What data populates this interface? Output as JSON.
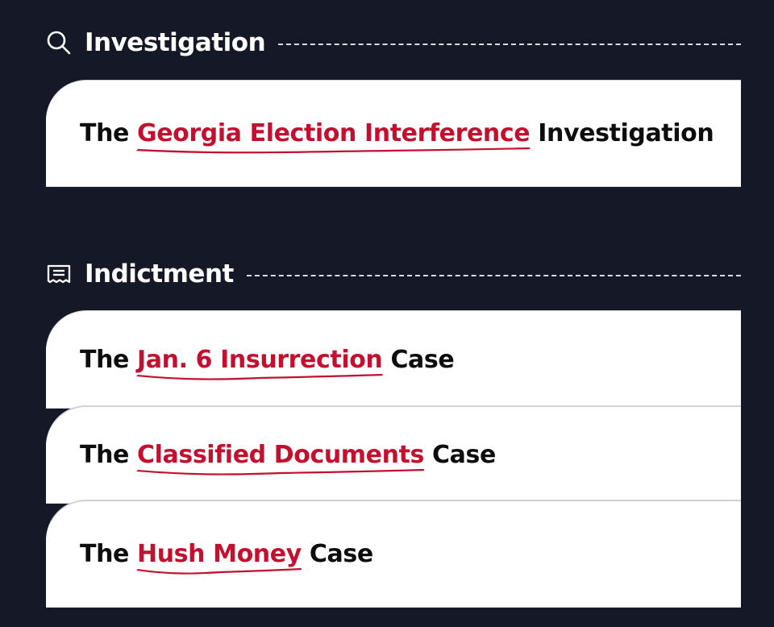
{
  "sections": [
    {
      "title": "Investigation",
      "icon": "search-icon",
      "cards": [
        {
          "prefix": "The",
          "link": "Georgia Election Interference",
          "suffix": "Investigation"
        }
      ]
    },
    {
      "title": "Indictment",
      "icon": "receipt-icon",
      "cards": [
        {
          "prefix": "The",
          "link": "Jan. 6 Insurrection",
          "suffix": "Case"
        },
        {
          "prefix": "The",
          "link": "Classified Documents",
          "suffix": "Case"
        },
        {
          "prefix": "The",
          "link": "Hush Money",
          "suffix": "Case"
        }
      ]
    }
  ],
  "colors": {
    "background": "#151826",
    "accent": "#c4102f",
    "card": "#ffffff",
    "text": "#0d0d0d"
  }
}
